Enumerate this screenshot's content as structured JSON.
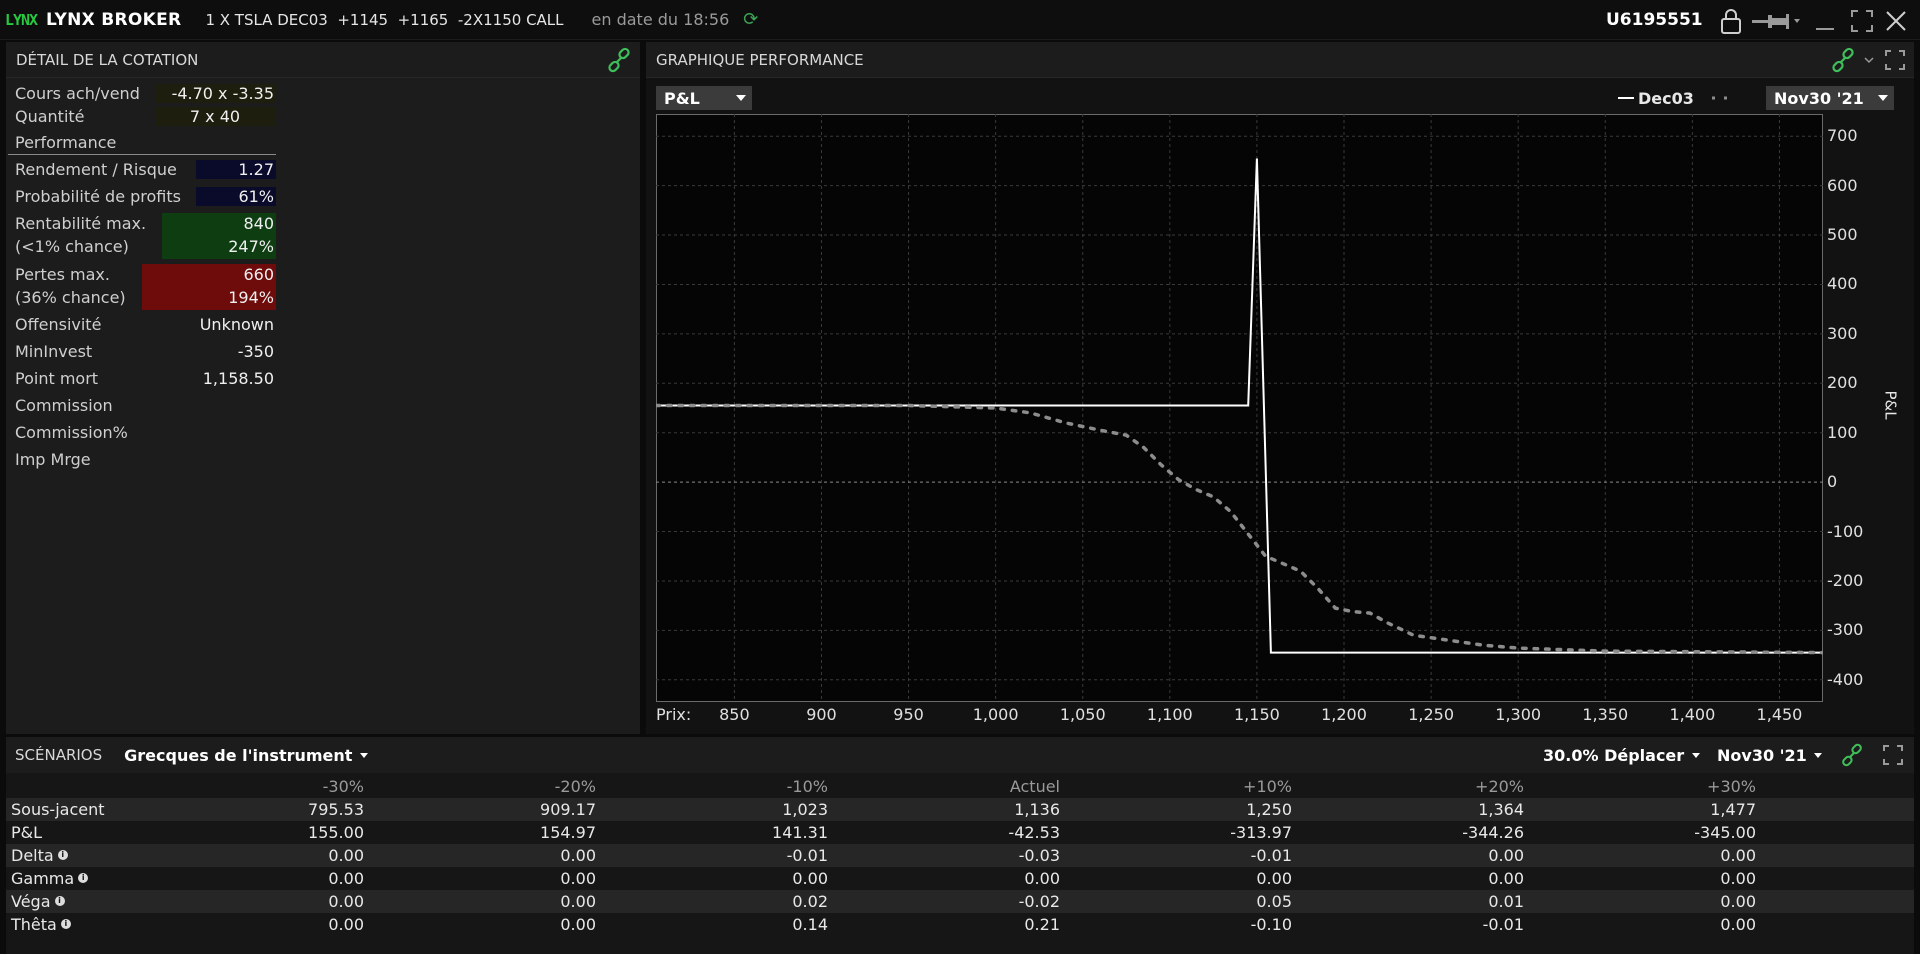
{
  "titlebar": {
    "logo": "LYNX",
    "brand": "LYNX BROKER",
    "strategy": "1 X TSLA DEC03  +1145  +1165  -2X1150 CALL",
    "as_of": "en date du 18:56",
    "account": "U6195551"
  },
  "quote_detail": {
    "title": "DÉTAIL DE LA COTATION",
    "rows": [
      {
        "label": "Cours ach/vend",
        "value": "-4.70 x -3.35"
      },
      {
        "label": "Quantité",
        "value": "7 x 40"
      }
    ],
    "performance_header": "Performance",
    "perf_rows": [
      {
        "label": "Rendement / Risque",
        "value": "1.27"
      },
      {
        "label": "Probabilité de profits",
        "value": "61%"
      }
    ],
    "max_profit": {
      "label1": "Rentabilité max.",
      "label2": "(<1% chance)",
      "value1": "840",
      "value2": "247%"
    },
    "max_loss": {
      "label1": "Pertes max.",
      "label2": "(36% chance)",
      "value1": "660",
      "value2": "194%"
    },
    "other_rows": [
      {
        "label": "Offensivité",
        "value": "Unknown"
      },
      {
        "label": "MinInvest",
        "value": "-350"
      },
      {
        "label": "Point mort",
        "value": "1,158.50"
      },
      {
        "label": "Commission",
        "value": ""
      },
      {
        "label": "Commission%",
        "value": ""
      },
      {
        "label": "Imp Mrge",
        "value": ""
      }
    ]
  },
  "performance_graph": {
    "title": "GRAPHIQUE PERFORMANCE",
    "metric_select": "P&L",
    "date_select": "Nov30 '21",
    "prix_label": "Prix:"
  },
  "chart_data": {
    "type": "line",
    "xlabel": "Prix:",
    "ylabel": "P&L",
    "xlim": [
      805,
      1475
    ],
    "ylim": [
      -445,
      745
    ],
    "x_ticks": [
      850,
      900,
      950,
      1000,
      1050,
      1100,
      1150,
      1200,
      1250,
      1300,
      1350,
      1400,
      1450
    ],
    "x_tick_labels": [
      "850",
      "900",
      "950",
      "1,000",
      "1,050",
      "1,100",
      "1,150",
      "1,200",
      "1,250",
      "1,300",
      "1,350",
      "1,400",
      "1,450"
    ],
    "y_ticks": [
      700,
      600,
      500,
      400,
      300,
      200,
      100,
      0,
      -100,
      -200,
      -300,
      -400
    ],
    "grid": true,
    "legend_position": "top-right",
    "series": [
      {
        "name": "Dec03",
        "style": "solid",
        "color": "#ffffff",
        "points": [
          [
            805,
            155
          ],
          [
            1145,
            155
          ],
          [
            1150,
            655
          ],
          [
            1158,
            -345
          ],
          [
            1475,
            -345
          ]
        ]
      },
      {
        "name": "",
        "style": "dotted",
        "color": "#8c8c8c",
        "points": [
          [
            805,
            155
          ],
          [
            950,
            155
          ],
          [
            1000,
            150
          ],
          [
            1020,
            140
          ],
          [
            1040,
            120
          ],
          [
            1060,
            105
          ],
          [
            1075,
            95
          ],
          [
            1085,
            70
          ],
          [
            1095,
            35
          ],
          [
            1105,
            5
          ],
          [
            1115,
            -15
          ],
          [
            1125,
            -30
          ],
          [
            1135,
            -60
          ],
          [
            1145,
            -105
          ],
          [
            1155,
            -150
          ],
          [
            1165,
            -165
          ],
          [
            1175,
            -180
          ],
          [
            1185,
            -215
          ],
          [
            1195,
            -255
          ],
          [
            1205,
            -262
          ],
          [
            1215,
            -265
          ],
          [
            1225,
            -285
          ],
          [
            1240,
            -310
          ],
          [
            1260,
            -320
          ],
          [
            1280,
            -330
          ],
          [
            1300,
            -336
          ],
          [
            1350,
            -342
          ],
          [
            1475,
            -345
          ]
        ]
      }
    ]
  },
  "scenarios": {
    "title": "SCÉNARIOS",
    "view_select": "Grecques de l'instrument",
    "shift_select": "30.0% Déplacer",
    "date_select": "Nov30 '21",
    "columns": [
      "-30%",
      "-20%",
      "-10%",
      "Actuel",
      "+10%",
      "+20%",
      "+30%"
    ],
    "rows": [
      {
        "label": "Sous-jacent",
        "info": false,
        "values": [
          "795.53",
          "909.17",
          "1,023",
          "1,136",
          "1,250",
          "1,364",
          "1,477"
        ]
      },
      {
        "label": "P&L",
        "info": false,
        "values": [
          "155.00",
          "154.97",
          "141.31",
          "-42.53",
          "-313.97",
          "-344.26",
          "-345.00"
        ]
      },
      {
        "label": "Delta",
        "info": true,
        "values": [
          "0.00",
          "0.00",
          "-0.01",
          "-0.03",
          "-0.01",
          "0.00",
          "0.00"
        ]
      },
      {
        "label": "Gamma",
        "info": true,
        "values": [
          "0.00",
          "0.00",
          "0.00",
          "0.00",
          "0.00",
          "0.00",
          "0.00"
        ]
      },
      {
        "label": "Véga",
        "info": true,
        "values": [
          "0.00",
          "0.00",
          "0.02",
          "-0.02",
          "0.05",
          "0.01",
          "0.00"
        ]
      },
      {
        "label": "Thêta",
        "info": true,
        "values": [
          "0.00",
          "0.00",
          "0.14",
          "0.21",
          "-0.10",
          "-0.01",
          "0.00"
        ]
      }
    ]
  },
  "colors": {
    "accent_green": "#3fbf5a",
    "profit_bg": "#0f3d12",
    "loss_bg": "#6e0b0b",
    "value_bg_dark": "#0a0a2a",
    "value_bg_olive": "#1e1e0e"
  }
}
